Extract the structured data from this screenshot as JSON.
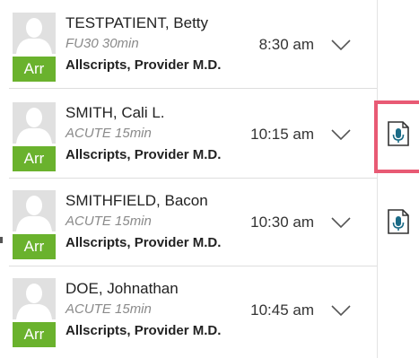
{
  "appointments": [
    {
      "patient_name": "TESTPATIENT, Betty",
      "appointment_type": "FU30 30min",
      "time": "8:30 am",
      "provider": "Allscripts, Provider M.D.",
      "status_badge": "Arr",
      "has_dictation": false
    },
    {
      "patient_name": "SMITH, Cali L.",
      "appointment_type": "ACUTE 15min",
      "time": "10:15 am",
      "provider": "Allscripts, Provider M.D.",
      "status_badge": "Arr",
      "has_dictation": true,
      "dictation_highlighted": true
    },
    {
      "patient_name": "SMITHFIELD, Bacon",
      "appointment_type": "ACUTE 15min",
      "time": "10:30 am",
      "provider": "Allscripts, Provider M.D.",
      "status_badge": "Arr",
      "has_dictation": true
    },
    {
      "patient_name": "DOE, Johnathan",
      "appointment_type": "ACUTE 15min",
      "time": "10:45 am",
      "provider": "Allscripts, Provider M.D.",
      "status_badge": "Arr",
      "has_dictation": false
    }
  ],
  "icons": {
    "avatar": "person-silhouette-icon",
    "expand": "chevron-down-icon",
    "dictation": "microphone-document-icon"
  },
  "colors": {
    "arrived_badge": "#6ab22d",
    "dictation_icon": "#1a6a86",
    "highlight": "#e85a74"
  }
}
